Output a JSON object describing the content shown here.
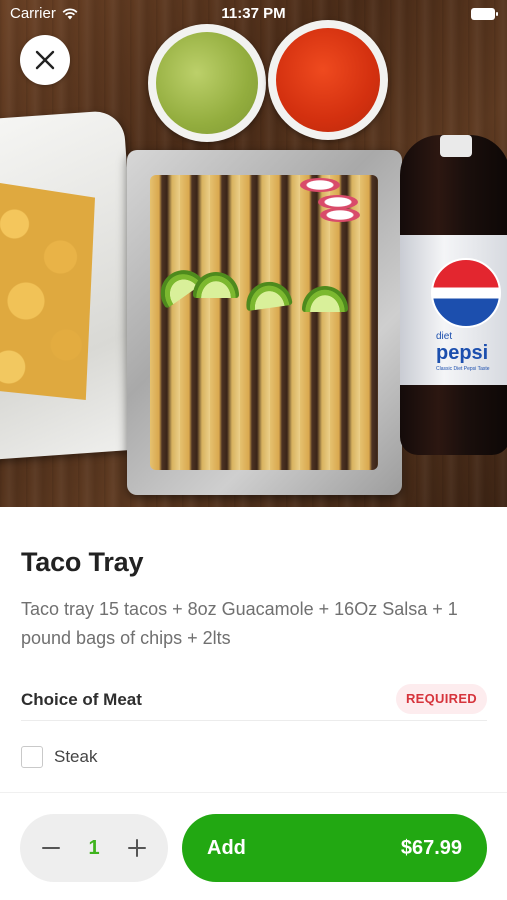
{
  "status_bar": {
    "carrier": "Carrier",
    "time": "11:37 PM"
  },
  "hero": {
    "close_icon": "close-icon",
    "brand_on_bottle": "pepsi",
    "bottle_small_text": "diet",
    "bottle_tagline": "Classic Diet Pepsi Taste"
  },
  "item": {
    "title": "Taco Tray",
    "description": "Taco tray 15 tacos + 8oz Guacamole + 16Oz Salsa + 1 pound bags of chips + 2lts"
  },
  "options_section": {
    "title": "Choice of Meat",
    "badge": "REQUIRED",
    "options": [
      {
        "label": "Steak",
        "checked": false
      }
    ]
  },
  "bottom_bar": {
    "quantity": "1",
    "minus_icon": "minus-icon",
    "plus_icon": "plus-icon",
    "add_label": "Add",
    "price": "$67.99"
  },
  "colors": {
    "accent_green": "#22a812",
    "quantity_green": "#3eb31d",
    "required_text": "#d6343c",
    "required_bg": "#fdecee"
  }
}
